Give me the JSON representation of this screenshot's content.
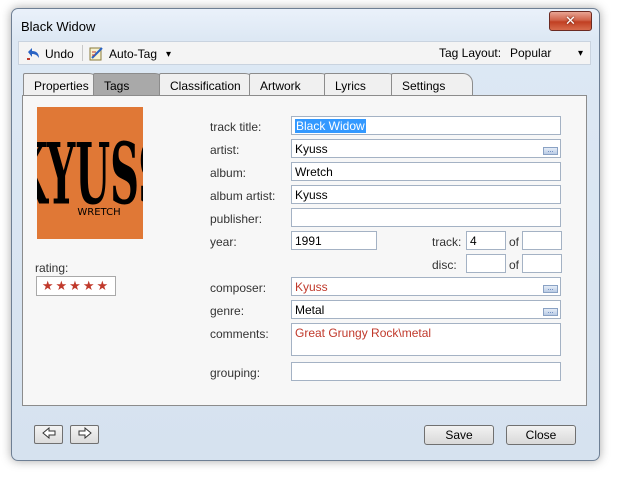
{
  "window": {
    "title": "Black Widow",
    "close_symbol": "✕"
  },
  "toolbar": {
    "undo_label": "Undo",
    "autotag_label": "Auto-Tag",
    "tag_layout_label": "Tag Layout:",
    "tag_layout_value": "Popular",
    "dropdown_glyph": "▾"
  },
  "tabs": [
    {
      "label": "Properties",
      "active": false
    },
    {
      "label": "Tags",
      "active": true
    },
    {
      "label": "Classification",
      "active": false
    },
    {
      "label": "Artwork",
      "active": false
    },
    {
      "label": "Lyrics",
      "active": false
    },
    {
      "label": "Settings",
      "active": false
    }
  ],
  "artwork": {
    "band_text": "KYUSS",
    "album_text": "WRETCH"
  },
  "rating": {
    "label": "rating:",
    "stars": "★★★★★",
    "value": 5,
    "max": 5
  },
  "fields": {
    "track_title": {
      "label": "track title:",
      "value": "Black Widow"
    },
    "artist": {
      "label": "artist:",
      "value": "Kyuss"
    },
    "album": {
      "label": "album:",
      "value": "Wretch"
    },
    "album_artist": {
      "label": "album artist:",
      "value": "Kyuss"
    },
    "publisher": {
      "label": "publisher:",
      "value": ""
    },
    "year": {
      "label": "year:",
      "value": "1991"
    },
    "track": {
      "label": "track:",
      "value": "4",
      "of_label": "of",
      "of_value": ""
    },
    "disc": {
      "label": "disc:",
      "value": "",
      "of_label": "of",
      "of_value": ""
    },
    "composer": {
      "label": "composer:",
      "value": "Kyuss"
    },
    "genre": {
      "label": "genre:",
      "value": "Metal"
    },
    "comments": {
      "label": "comments:",
      "value": "Great Grungy Rock\\metal"
    },
    "grouping": {
      "label": "grouping:",
      "value": ""
    }
  },
  "buttons": {
    "save": "Save",
    "close": "Close",
    "ellipsis": "..."
  },
  "colors": {
    "accent_red": "#c0392b",
    "selection": "#3399ff",
    "art_orange": "#e07836"
  }
}
